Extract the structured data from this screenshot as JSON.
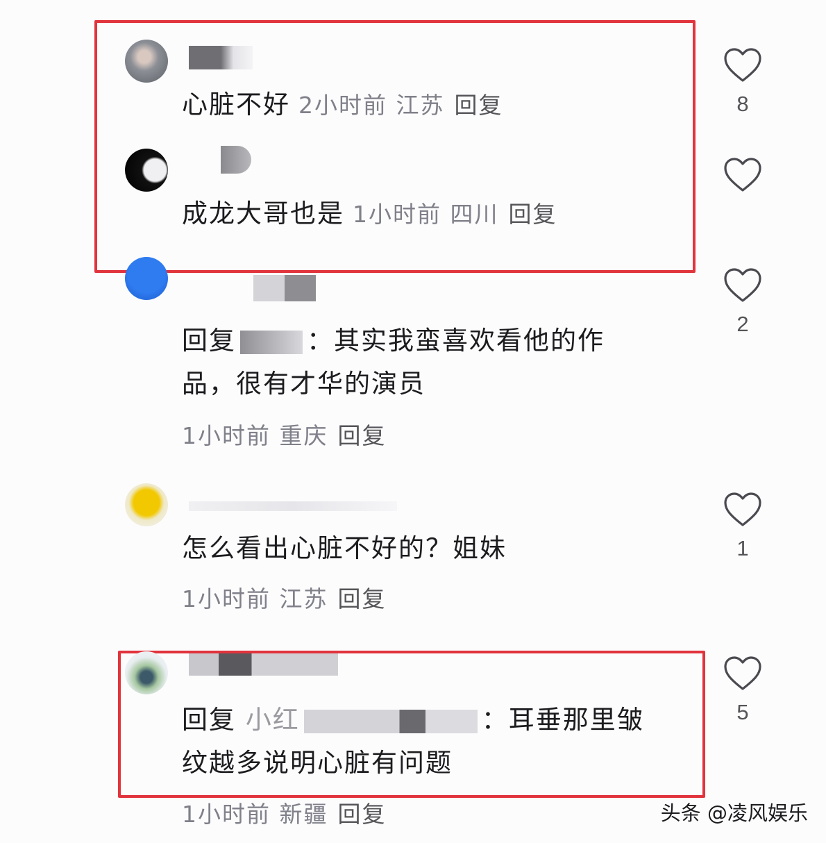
{
  "comments": [
    {
      "text": "心脏不好",
      "time": "2小时前",
      "location": "江苏",
      "reply_label": "回复",
      "likes": "8"
    },
    {
      "text": "成龙大哥也是",
      "time": "1小时前",
      "location": "四川",
      "reply_label": "回复"
    },
    {
      "reply_prefix": "回复",
      "line1": "其实我蛮喜欢看他的作",
      "line2": "品，很有才华的演员",
      "time": "1小时前",
      "location": "重庆",
      "reply_label": "回复",
      "likes": "2"
    },
    {
      "text": "怎么看出心脏不好的？姐妹",
      "time": "1小时前",
      "location": "江苏",
      "reply_label": "回复",
      "likes": "1"
    },
    {
      "reply_prefix": "回复",
      "reply_target": "小红",
      "line1": "耳垂那里皱",
      "line2": "纹越多说明心脏有问题",
      "time": "1小时前",
      "location": "新疆",
      "reply_label": "回复",
      "likes": "5"
    }
  ],
  "watermark": "头条 @凌风娱乐",
  "colors": {
    "highlight": "#e1343d",
    "meta": "#80808a",
    "heart": "#4a4a50"
  },
  "icons": {
    "like": "heart-outline-icon"
  }
}
